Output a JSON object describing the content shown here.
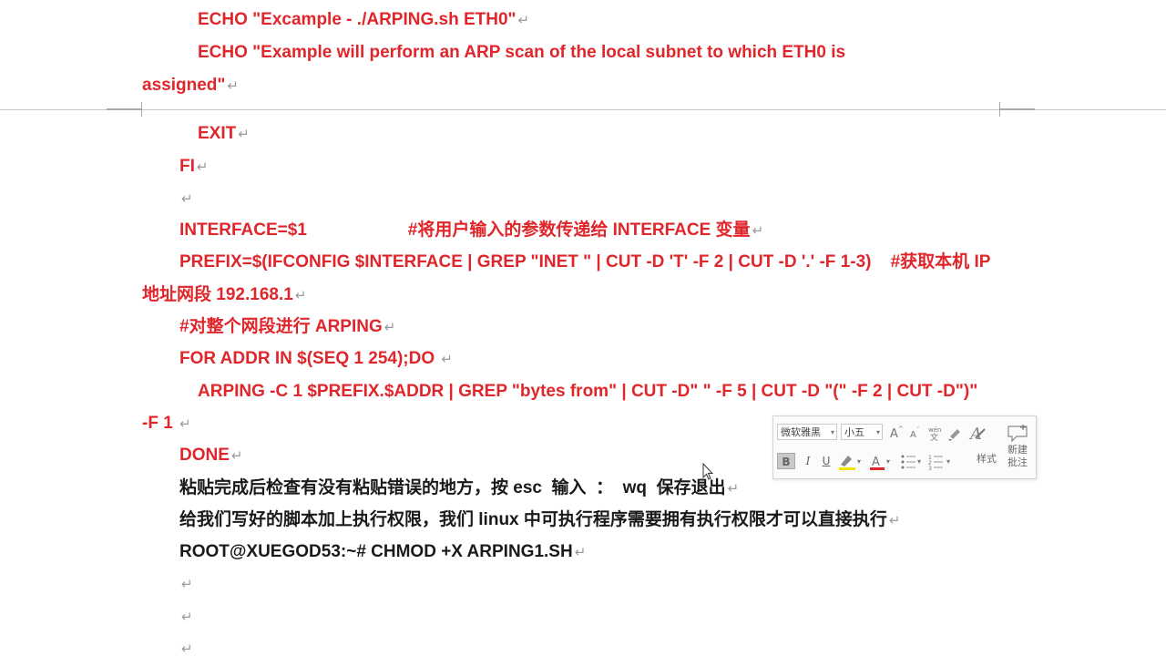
{
  "lines": [
    {
      "text": "ECHO \"Excample - ./ARPING.sh ETH0\"",
      "mark": "↵",
      "color": "red"
    },
    {
      "text": "ECHO \"Example will perform an ARP scan of the local subnet to which ETH0 is",
      "mark": "",
      "color": "red"
    },
    {
      "text": "assigned\"",
      "mark": "↵",
      "color": "red"
    },
    {
      "text": "EXIT",
      "mark": "↵",
      "color": "red"
    },
    {
      "text": "FI",
      "mark": "↵",
      "color": "red"
    },
    {
      "text": "",
      "mark": "↵",
      "color": "red"
    },
    {
      "text": "INTERFACE=$1                     #将用户输入的参数传递给 INTERFACE 变量",
      "mark": "↵",
      "color": "red"
    },
    {
      "text": "PREFIX=$(IFCONFIG $INTERFACE | GREP \"INET \" | CUT -D 'T' -F 2 | CUT -D '.' -F 1-3)    #获取本机 IP",
      "mark": "",
      "color": "red"
    },
    {
      "text": "地址网段 192.168.1",
      "mark": "↵",
      "color": "red"
    },
    {
      "text": "#对整个网段进行 ARPING",
      "mark": "↵",
      "color": "red"
    },
    {
      "text": "FOR ADDR IN $(SEQ 1 254);DO ",
      "mark": "↵",
      "color": "red"
    },
    {
      "text": "ARPING -C 1 $PREFIX.$ADDR | GREP \"bytes from\" | CUT -D\" \" -F 5 | CUT -D \"(\" -F 2 | CUT -D\")\"",
      "mark": "",
      "color": "red"
    },
    {
      "text": "-F 1 ",
      "mark": "↵",
      "color": "red"
    },
    {
      "text": "DONE",
      "mark": "↵",
      "color": "red"
    },
    {
      "text": "粘贴完成后检查有没有粘贴错误的地方，按 esc  输入  ：  wq  保存退出",
      "mark": "↵",
      "color": "black"
    },
    {
      "text": "给我们写好的脚本加上执行权限，我们 linux 中可执行程序需要拥有执行权限才可以直接执行",
      "mark": "↵",
      "color": "black"
    },
    {
      "text": "ROOT@XUEGOD53:~# CHMOD +X ARPING1.SH",
      "mark": "↵",
      "color": "black"
    },
    {
      "text": "",
      "mark": "↵",
      "color": "black"
    },
    {
      "text": "",
      "mark": "↵",
      "color": "black"
    },
    {
      "text": "",
      "mark": "↵",
      "color": "black"
    }
  ],
  "toolbar": {
    "font_name": "微软雅黑",
    "font_size": "小五",
    "bold": "B",
    "italic": "I",
    "underline": "U",
    "style_label": "样式",
    "new_comment_line1": "新建",
    "new_comment_line2": "批注"
  },
  "colors": {
    "text_red": "#e0262b",
    "text_black": "#1a1a1a",
    "toolbar_bg": "#fbfbfb"
  }
}
